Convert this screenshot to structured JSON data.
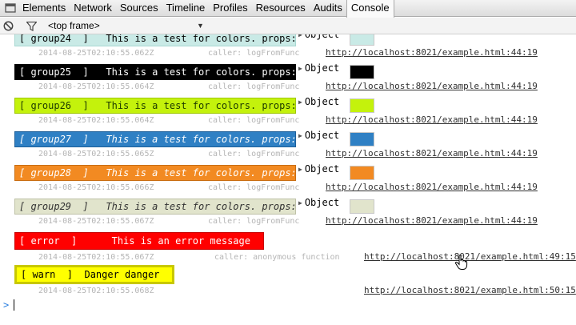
{
  "tabs": [
    "Elements",
    "Network",
    "Sources",
    "Timeline",
    "Profiles",
    "Resources",
    "Audits",
    "Console"
  ],
  "active_tab": "Console",
  "toolbar": {
    "frame_label": "<top frame>"
  },
  "messages": [
    {
      "text": "[ group24  ]   This is a test for colors. props:",
      "bg": "#c9eae6",
      "fg": "#000000",
      "border": "#a8d8d2",
      "timestamp": "2014-08-25T02:10:55.062Z",
      "caller": "caller: logFromFunc",
      "link": "http://localhost:8021/example.html:44:19",
      "object": "Object",
      "swatch": "#c9eae6"
    },
    {
      "text": "[ group25  ]   This is a test for colors. props:",
      "bg": "#000000",
      "fg": "#ffffff",
      "border": "#000000",
      "timestamp": "2014-08-25T02:10:55.064Z",
      "caller": "caller: logFromFunc",
      "link": "http://localhost:8021/example.html:44:19",
      "object": "Object",
      "swatch": "#000000"
    },
    {
      "text": "[ group26  ]   This is a test for colors. props:",
      "bg": "#c4f20c",
      "fg": "#1d3a00",
      "border": "#9ec600",
      "timestamp": "2014-08-25T02:10:55.064Z",
      "caller": "caller: logFromFunc",
      "link": "http://localhost:8021/example.html:44:19",
      "object": "Object",
      "swatch": "#c4f20c"
    },
    {
      "text": "[ group27  ]   This is a test for colors. props:",
      "bg": "#2f80c4",
      "fg": "#ffffff",
      "border": "#1d5f99",
      "timestamp": "2014-08-25T02:10:55.065Z",
      "caller": "caller: logFromFunc",
      "link": "http://localhost:8021/example.html:44:19",
      "object": "Object",
      "swatch": "#2f80c4"
    },
    {
      "text": "[ group28  ]   This is a test for colors. props:",
      "bg": "#f28a22",
      "fg": "#ffffff",
      "border": "#c96e12",
      "timestamp": "2014-08-25T02:10:55.066Z",
      "caller": "caller: logFromFunc",
      "link": "http://localhost:8021/example.html:44:19",
      "object": "Object",
      "swatch": "#f28a22"
    },
    {
      "text": "[ group29  ]   This is a test for colors. props:",
      "bg": "#e1e4cc",
      "fg": "#333333",
      "border": "#bfc2a8",
      "timestamp": "2014-08-25T02:10:55.067Z",
      "caller": "caller: logFromFunc",
      "link": "http://localhost:8021/example.html:44:19",
      "object": "Object",
      "swatch": "#e1e4cc"
    }
  ],
  "error": {
    "text": "[ error  ]      This is an error message",
    "bg": "#ff0000",
    "fg": "#ffffff",
    "timestamp": "2014-08-25T02:10:55.067Z",
    "caller": "caller: anonymous function",
    "link": "http://localhost:8021/example.html:49:15"
  },
  "warn": {
    "text": "[ warn  ]  Danger danger",
    "bg": "#ffff00",
    "fg": "#000000",
    "border": "#c8c800",
    "timestamp": "2014-08-25T02:10:55.068Z",
    "link": "http://localhost:8021/example.html:50:15"
  },
  "prompt": ">"
}
